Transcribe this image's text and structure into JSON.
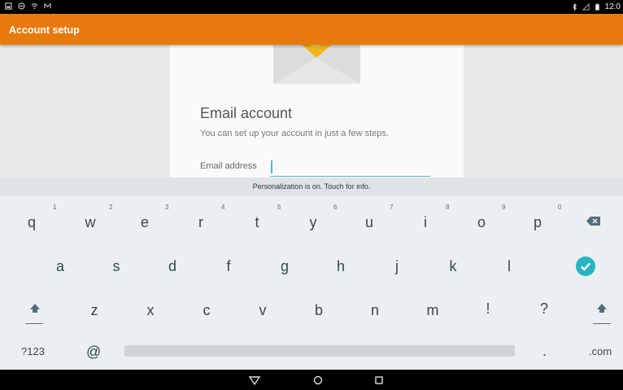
{
  "status_bar": {
    "left_icons": [
      "gallery-icon",
      "minus-circle-icon",
      "wifi-icon",
      "m-icon"
    ],
    "right_icons": [
      "bluetooth-icon",
      "signal-icon",
      "battery-icon"
    ],
    "time": "12:0"
  },
  "app_bar": {
    "title": "Account setup",
    "color": "#e8790d"
  },
  "setup_card": {
    "title": "Email account",
    "subtitle": "You can set up your account in just a few steps.",
    "email_label": "Email address",
    "email_value": ""
  },
  "keyboard": {
    "suggestion_strip": "Personalization is on. Touch for info.",
    "row1": [
      "q",
      "w",
      "e",
      "r",
      "t",
      "y",
      "u",
      "i",
      "o",
      "p"
    ],
    "row1_hints": [
      "1",
      "2",
      "3",
      "4",
      "5",
      "6",
      "7",
      "8",
      "9",
      "0"
    ],
    "row2": [
      "a",
      "s",
      "d",
      "f",
      "g",
      "h",
      "j",
      "k",
      "l"
    ],
    "row3": [
      "z",
      "x",
      "c",
      "v",
      "b",
      "n",
      "m",
      "!",
      "?"
    ],
    "symbols_key": "?123",
    "at_key": "@",
    "period_key": ".",
    "com_key": ".com",
    "accent_color": "#26b5c0"
  },
  "nav_bar": {
    "buttons": [
      "back-icon",
      "home-icon",
      "recents-icon"
    ]
  }
}
